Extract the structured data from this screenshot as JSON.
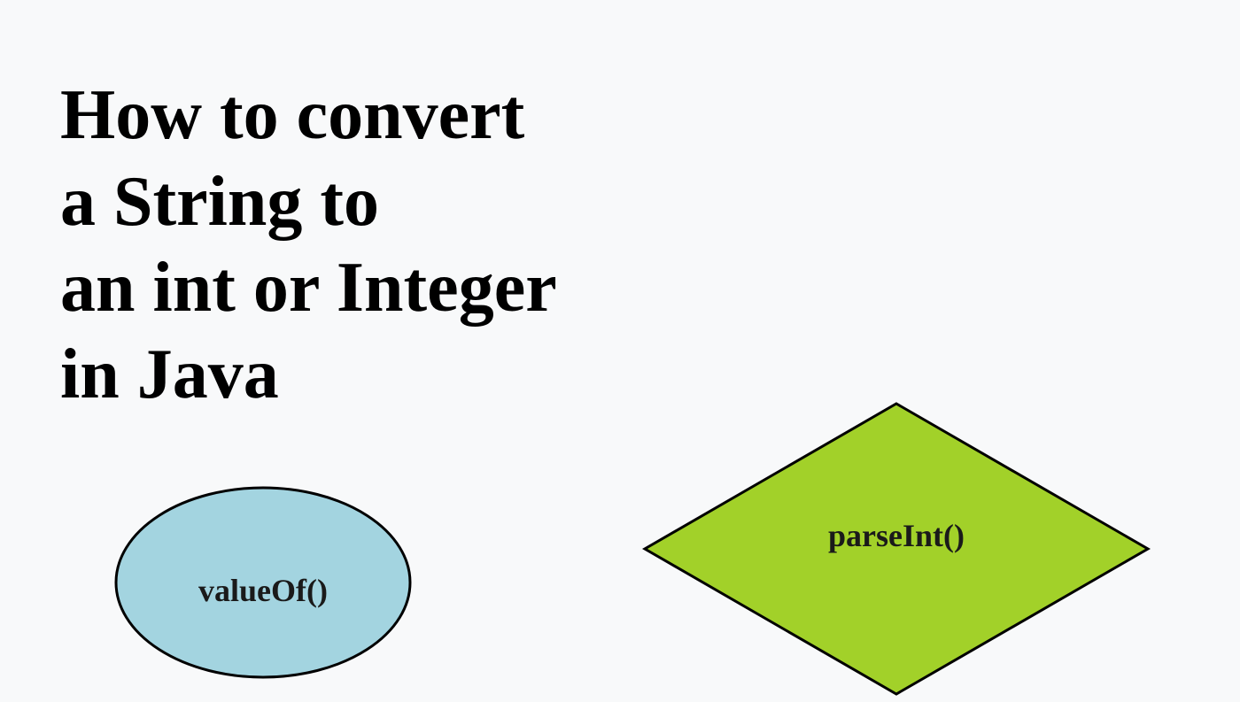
{
  "title": {
    "line1": "How to convert",
    "line2": "a String to",
    "line3": "an int or Integer",
    "line4": "in Java"
  },
  "shapes": {
    "ellipse": {
      "label": "valueOf()",
      "fill": "#a3d4e0",
      "stroke": "#000000"
    },
    "diamond": {
      "label": "parseInt()",
      "fill": "#a2d129",
      "stroke": "#000000"
    }
  }
}
